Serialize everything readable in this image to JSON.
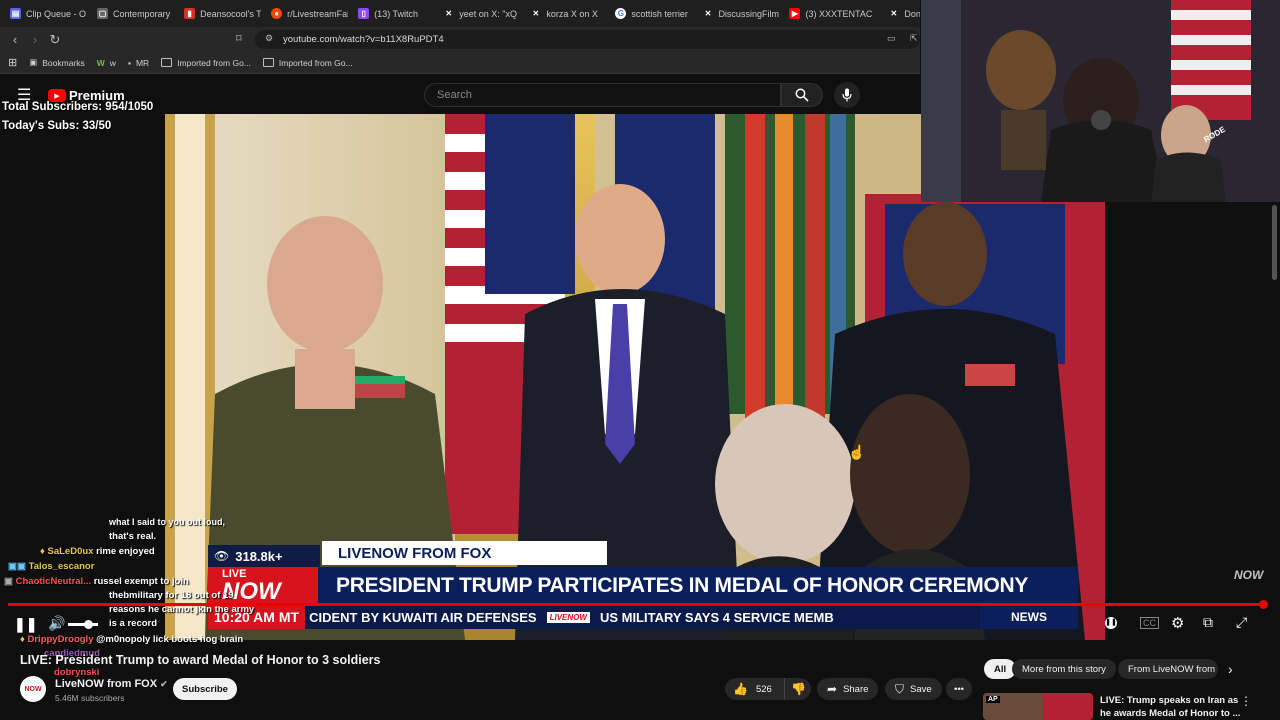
{
  "browser": {
    "tabs": [
      {
        "label": "Clip Queue - O",
        "icon": "clip-icon",
        "color": "#5865f2"
      },
      {
        "label": "Contemporary",
        "icon": "page-icon",
        "color": "#9e9e9e"
      },
      {
        "label": "Deansocool's T",
        "icon": "chart-icon",
        "color": "#d93025"
      },
      {
        "label": "r/LivestreamFail",
        "icon": "reddit-icon",
        "color": "#ff4500"
      },
      {
        "label": "(13) Twitch",
        "icon": "twitch-icon",
        "color": "#9146ff"
      },
      {
        "label": "yeet on X: \"xQ",
        "icon": "x-icon",
        "color": "#000000"
      },
      {
        "label": "korza X on X",
        "icon": "x-icon",
        "color": "#000000"
      },
      {
        "label": "scottish terrier",
        "icon": "google-icon",
        "color": "#ffffff"
      },
      {
        "label": "DiscussingFilm",
        "icon": "x-icon",
        "color": "#000000"
      },
      {
        "label": "(3) XXXTENTAC",
        "icon": "youtube-icon",
        "color": "#ff0000"
      },
      {
        "label": "Dona",
        "icon": "x-icon",
        "color": "#000000"
      }
    ],
    "url": "youtube.com/watch?v=b11X8RuPDT4",
    "bookmarks": [
      "Bookmarks",
      "w",
      "MR",
      "Imported from Go...",
      "Imported from Go..."
    ]
  },
  "youtube": {
    "logo_text": "Premium",
    "search_placeholder": "Search"
  },
  "stream_overlay": {
    "total_subs": "Total Subscribers: 954/1050",
    "todays_subs": "Today's Subs: 33/50"
  },
  "lower_third": {
    "viewers": "318.8k+",
    "source": "LIVENOW FROM FOX",
    "logo_top": "LIVE",
    "logo_bottom": "NOW",
    "headline": "PRESIDENT TRUMP PARTICIPATES IN MEDAL OF HONOR CEREMONY",
    "time": "10:20 AM MT",
    "ticker": "CIDENT BY KUWAITI AIR DEFENSES",
    "ticker_logo": "LIVENOW",
    "ticker_2": "US MILITARY SAYS 4 SERVICE MEMB",
    "news_tag": "NEWS",
    "corner_logo": "NOW"
  },
  "chat": [
    {
      "user": "",
      "text": "what I said to you out loud,",
      "color": "#ffffff"
    },
    {
      "user": "",
      "text": "that's real.",
      "color": "#ffffff"
    },
    {
      "user": "SaLeD0ux",
      "text": "rime enjoyed",
      "color": "#e6c84a"
    },
    {
      "user": "Talos_escanor",
      "text": "",
      "color": "#e6c84a"
    },
    {
      "user": "ChaoticNeutral...",
      "text": "russel exempt to join",
      "color": "#ff4d4d"
    },
    {
      "user": "",
      "text": "thebmilitary for 18 out of 19",
      "color": "#ffffff"
    },
    {
      "user": "",
      "text": "reasons he cannot jkin the army",
      "color": "#ffffff"
    },
    {
      "user": "",
      "text": "is a record",
      "color": "#ffffff"
    },
    {
      "user": "DrippyDroogly",
      "text": "@m0nopoly lick boots hog brain",
      "color": "#ff5c5c"
    },
    {
      "user": "candiedmud",
      "text": "",
      "color": "#9b59b6"
    },
    {
      "user": "dobrynski",
      "text": "",
      "color": "#ff4d4d"
    }
  ],
  "video": {
    "title": "LIVE: President Trump to award Medal of Honor to 3 soldiers",
    "channel": "LiveNOW from FOX",
    "subscribers": "5.46M subscribers",
    "subscribe_label": "Subscribe",
    "likes": "526",
    "share_label": "Share",
    "save_label": "Save",
    "progress": 1.0
  },
  "chips": [
    "All",
    "More from this story",
    "From LiveNOW from"
  ],
  "recommended": {
    "title_line1": "LIVE: Trump speaks on Iran as",
    "title_line2": "he awards Medal of Honor to ...",
    "thumb_badge": "AP"
  },
  "colors": {
    "youtube_red": "#ff0000",
    "fox_blue": "#0a1f5c",
    "fox_red": "#d7141e"
  }
}
